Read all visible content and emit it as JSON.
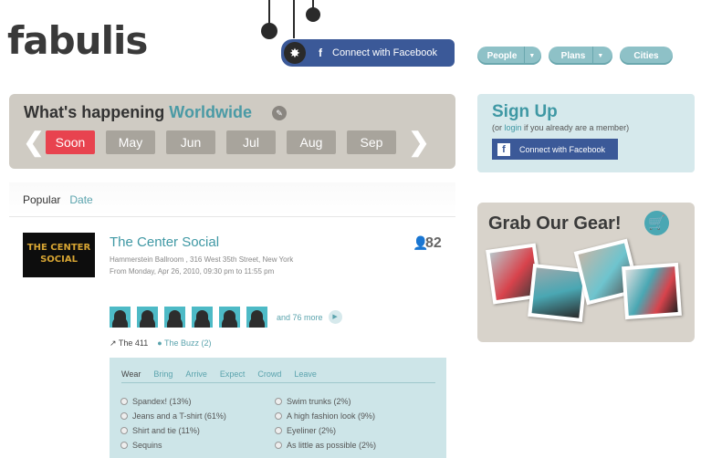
{
  "brand": {
    "logo": "fabulis"
  },
  "header": {
    "connect_facebook": "Connect with Facebook",
    "nav": [
      {
        "label": "People",
        "dropdown": true
      },
      {
        "label": "Plans",
        "dropdown": true
      },
      {
        "label": "Cities",
        "dropdown": false
      }
    ]
  },
  "happening": {
    "title": "What's happening",
    "location": "Worldwide",
    "months": [
      "Soon",
      "May",
      "Jun",
      "Jul",
      "Aug",
      "Sep"
    ],
    "active_month": "Soon"
  },
  "feed_tabs": {
    "popular": "Popular",
    "date": "Date"
  },
  "event": {
    "image_text_1": "THE CENTER",
    "image_text_2": "SOCIAL",
    "title": "The Center Social",
    "venue": "Hammerstein Ballroom , 316 West 35th Street, New York",
    "time": "From Monday, Apr 26, 2010, 09:30 pm to 11:55 pm",
    "attendees": 82,
    "more": "and 76 more",
    "link_411": "The 411",
    "link_buzz": "The Buzz (2)"
  },
  "wear": {
    "tabs": [
      "Wear",
      "Bring",
      "Arrive",
      "Expect",
      "Crowd",
      "Leave"
    ],
    "selected_tab": "Wear",
    "options_left": [
      "Spandex! (13%)",
      "Jeans and a T-shirt (61%)",
      "Shirt and tie (11%)",
      "Sequins"
    ],
    "options_right": [
      "Swim trunks (2%)",
      "A high fashion look (9%)",
      "Eyeliner (2%)",
      "As little as possible (2%)"
    ]
  },
  "signup": {
    "title": "Sign Up",
    "sub_prefix": "(or ",
    "sub_login": "login",
    "sub_suffix": " if you already are a member)",
    "fb_button": "Connect with Facebook"
  },
  "gear": {
    "title": "Grab Our Gear!"
  },
  "colors": {
    "accent": "#3f98a4",
    "active": "#e8434f",
    "facebook": "#3b5998"
  }
}
